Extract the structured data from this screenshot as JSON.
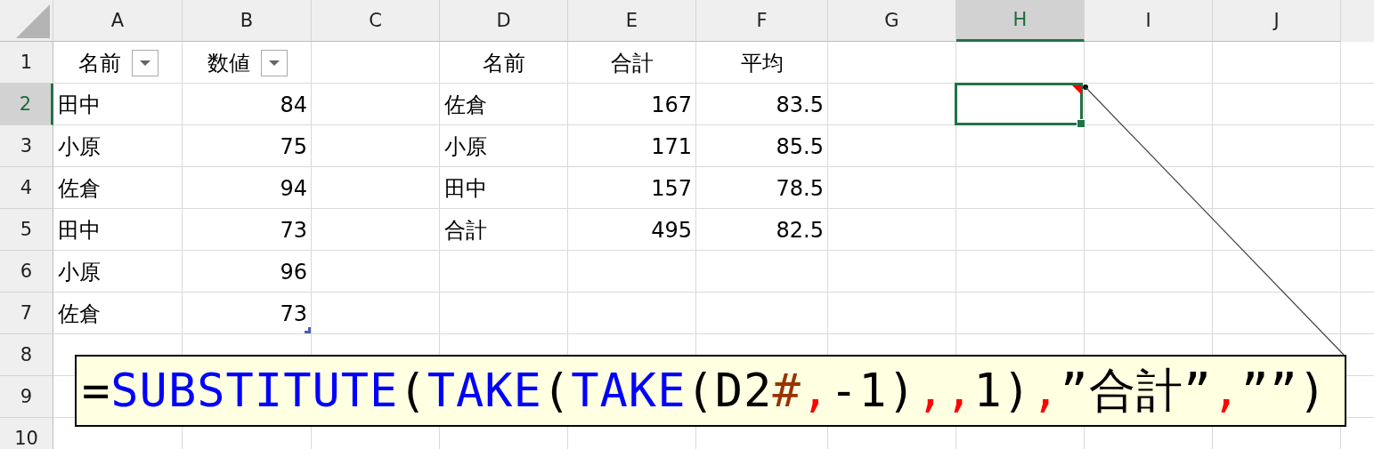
{
  "columns": [
    {
      "label": "A",
      "selected": false
    },
    {
      "label": "B",
      "selected": false
    },
    {
      "label": "C",
      "selected": false
    },
    {
      "label": "D",
      "selected": false
    },
    {
      "label": "E",
      "selected": false
    },
    {
      "label": "F",
      "selected": false
    },
    {
      "label": "G",
      "selected": false
    },
    {
      "label": "H",
      "selected": true
    },
    {
      "label": "I",
      "selected": false
    },
    {
      "label": "J",
      "selected": false
    }
  ],
  "row_headers": [
    {
      "label": "1",
      "selected": false
    },
    {
      "label": "2",
      "selected": true
    },
    {
      "label": "3",
      "selected": false
    },
    {
      "label": "4",
      "selected": false
    },
    {
      "label": "5",
      "selected": false
    },
    {
      "label": "6",
      "selected": false
    },
    {
      "label": "7",
      "selected": false
    },
    {
      "label": "8",
      "selected": false
    },
    {
      "label": "9",
      "selected": false
    },
    {
      "label": "10",
      "selected": false
    }
  ],
  "data_table": {
    "headers": [
      {
        "text": "名前",
        "filter": true
      },
      {
        "text": "数値",
        "filter": true
      }
    ],
    "rows": [
      [
        "田中",
        "84"
      ],
      [
        "小原",
        "75"
      ],
      [
        "佐倉",
        "94"
      ],
      [
        "田中",
        "73"
      ],
      [
        "小原",
        "96"
      ],
      [
        "佐倉",
        "73"
      ]
    ]
  },
  "summary_table": {
    "headers": [
      "名前",
      "合計",
      "平均"
    ],
    "rows": [
      [
        "佐倉",
        "167",
        "83.5"
      ],
      [
        "小原",
        "171",
        "85.5"
      ],
      [
        "田中",
        "157",
        "78.5"
      ],
      [
        "合計",
        "495",
        "82.5"
      ]
    ]
  },
  "active_cell_has_comment": true,
  "callout": {
    "segments": [
      {
        "text": "=",
        "color": "#000000"
      },
      {
        "text": "SUBSTITUTE",
        "color": "#0000ff"
      },
      {
        "text": "(",
        "color": "#000000"
      },
      {
        "text": "TAKE",
        "color": "#0000ff"
      },
      {
        "text": "(",
        "color": "#000000"
      },
      {
        "text": "TAKE",
        "color": "#0000ff"
      },
      {
        "text": "(D2",
        "color": "#000000"
      },
      {
        "text": "#",
        "color": "#993300"
      },
      {
        "text": ",",
        "color": "#ff0000"
      },
      {
        "text": "-1)",
        "color": "#000000"
      },
      {
        "text": ",,",
        "color": "#ff0000"
      },
      {
        "text": "1)",
        "color": "#000000"
      },
      {
        "text": ",",
        "color": "#ff0000"
      },
      {
        "text": "”合計”",
        "color": "#000000"
      },
      {
        "text": ",",
        "color": "#ff0000"
      },
      {
        "text": "””)",
        "color": "#000000"
      }
    ]
  }
}
